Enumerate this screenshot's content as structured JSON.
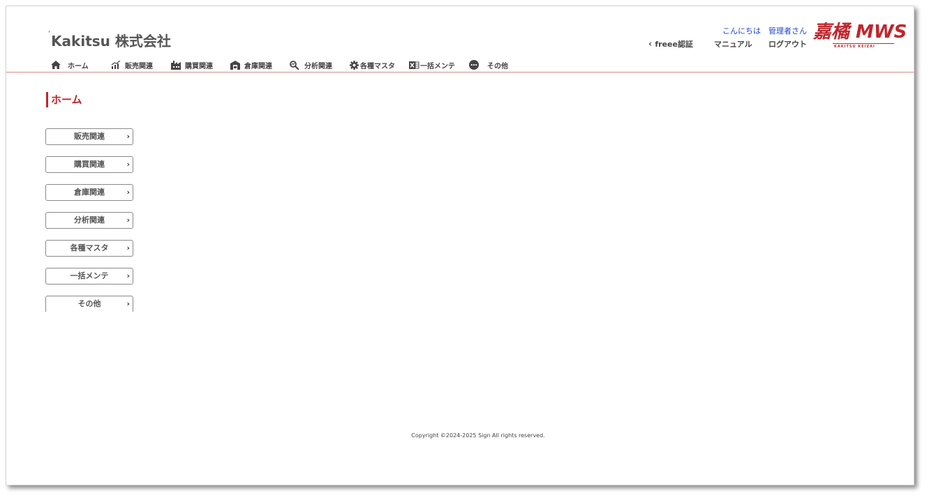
{
  "header": {
    "company_name": "Kakitsu 株式会社",
    "greeting": "こんにちは",
    "user_name": "管理者さん",
    "links": {
      "freee": "freee認証",
      "manual": "マニュアル",
      "logout": "ログアウト"
    },
    "logo": {
      "main_text": "嘉橘 MWS",
      "sub_text": "KAKITSU KEIZAI",
      "brand_color": "#c0262c"
    }
  },
  "nav": {
    "items": [
      {
        "label": "ホーム",
        "icon": "home-icon"
      },
      {
        "label": "販売関連",
        "icon": "sales-chart-icon"
      },
      {
        "label": "購買関連",
        "icon": "factory-icon"
      },
      {
        "label": "倉庫関連",
        "icon": "warehouse-icon"
      },
      {
        "label": "分析関連",
        "icon": "analysis-search-icon"
      },
      {
        "label": "各種マスタ",
        "icon": "gear-icon"
      },
      {
        "label": "一括メンテ",
        "icon": "excel-icon"
      },
      {
        "label": "その他",
        "icon": "more-dots-icon"
      }
    ]
  },
  "main": {
    "title": "ホーム",
    "menu_buttons": [
      {
        "label": "販売関連"
      },
      {
        "label": "購買関連"
      },
      {
        "label": "倉庫関連"
      },
      {
        "label": "分析関連"
      },
      {
        "label": "各種マスタ"
      },
      {
        "label": "一括メンテ"
      },
      {
        "label": "その他"
      }
    ],
    "chevron": "›"
  },
  "footer": {
    "copyright": "Copyright ©2024-2025 Sign All rights reserved."
  },
  "colors": {
    "accent": "#c0262c",
    "link_blue": "#1f45c9",
    "text_gray": "#444444"
  }
}
